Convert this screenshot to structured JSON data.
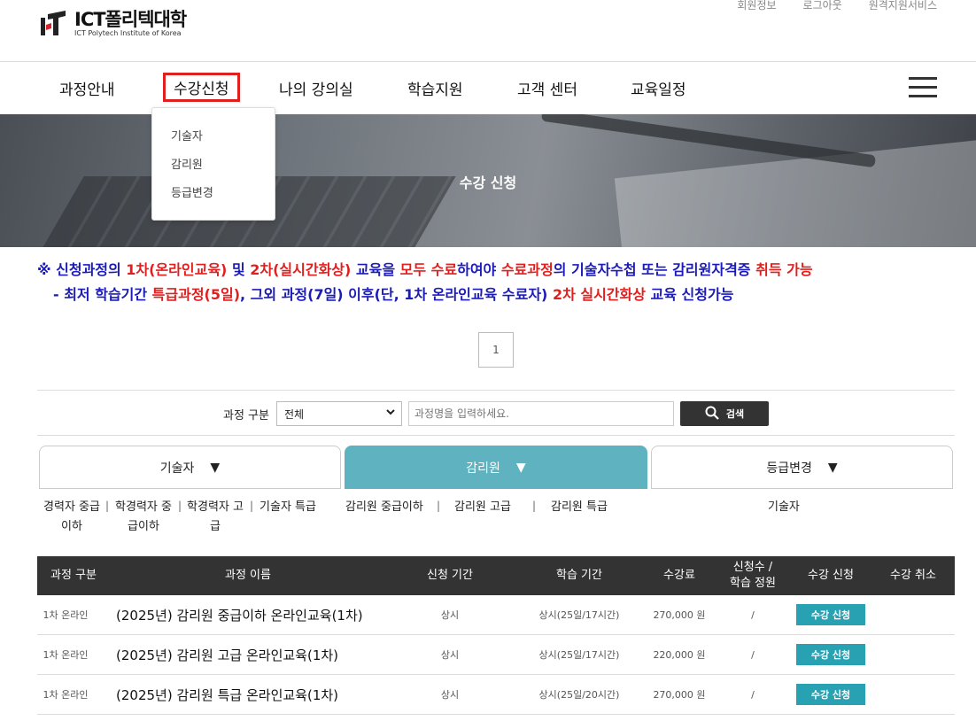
{
  "header": {
    "logo_title": "ICT폴리텍대학",
    "logo_sub": "ICT Polytech Institute of Korea",
    "util_links": [
      "회원정보",
      "로그아웃",
      "원격지원서비스"
    ]
  },
  "nav": {
    "items": [
      "과정안내",
      "수강신청",
      "나의 강의실",
      "학습지원",
      "고객 센터",
      "교육일정"
    ],
    "dropdown": [
      "기술자",
      "감리원",
      "등급변경"
    ]
  },
  "banner": {
    "title": "수강 신청"
  },
  "notice": {
    "line1": [
      {
        "t": "※ 신청과정의 ",
        "c": "b"
      },
      {
        "t": "1차(온라인교육)",
        "c": "r"
      },
      {
        "t": " 및 ",
        "c": "b"
      },
      {
        "t": "2차(실시간화상)",
        "c": "r"
      },
      {
        "t": " 교육을 ",
        "c": "b"
      },
      {
        "t": "모두 수료",
        "c": "r"
      },
      {
        "t": "하여야 ",
        "c": "b"
      },
      {
        "t": "수료과정",
        "c": "r"
      },
      {
        "t": "의 기술자수첩 또는 감리원자격증 ",
        "c": "b"
      },
      {
        "t": "취득 가능",
        "c": "r"
      }
    ],
    "line2": [
      {
        "t": " - 최저 학습기간 ",
        "c": "b"
      },
      {
        "t": "특급과정(5일)",
        "c": "r"
      },
      {
        "t": ", 그외 과정(7일) 이후(단, 1차 온라인교육 수료자) ",
        "c": "b"
      },
      {
        "t": "2차 실시간화상",
        "c": "r"
      },
      {
        "t": " 교육 신청가능",
        "c": "b"
      }
    ]
  },
  "pagination": {
    "current": "1"
  },
  "search": {
    "label": "과정 구분",
    "select_value": "전체",
    "placeholder": "과정명을 입력하세요.",
    "button": "검색"
  },
  "tabs": [
    "기술자",
    "감리원",
    "등급변경"
  ],
  "tab_arrow": "▼",
  "sub_categories": {
    "tech": [
      "경력자 중급\n이하",
      "학경력자 중\n급이하",
      "학경력자 고\n급",
      "기술자 특급"
    ],
    "supervisor": [
      "감리원 중급이하",
      "감리원 고급",
      "감리원 특급"
    ],
    "grade": [
      "기술자"
    ]
  },
  "table": {
    "headers": [
      "과정 구분",
      "과정 이름",
      "신청 기간",
      "학습 기간",
      "수강료",
      "신청수 /\n학습 정원",
      "수강 신청",
      "수강 취소"
    ],
    "rows": [
      {
        "type": "1차 온라인",
        "name": "(2025년) 감리원 중급이하 온라인교육(1차)",
        "apply_period": "상시",
        "study_period": "상시(25일/17시간)",
        "fee": "270,000 원",
        "count": "/",
        "button": "수강 신청"
      },
      {
        "type": "1차 온라인",
        "name": "(2025년) 감리원 고급 온라인교육(1차)",
        "apply_period": "상시",
        "study_period": "상시(25일/17시간)",
        "fee": "220,000 원",
        "count": "/",
        "button": "수강 신청"
      },
      {
        "type": "1차 온라인",
        "name": "(2025년) 감리원 특급 온라인교육(1차)",
        "apply_period": "상시",
        "study_period": "상시(25일/20시간)",
        "fee": "270,000 원",
        "count": "/",
        "button": "수강 신청"
      }
    ]
  },
  "colors": {
    "accent": "#5fb3c0",
    "button": "#28a2b3",
    "red": "#e0201f",
    "blue": "#1b1bb8",
    "dark": "#333333"
  }
}
